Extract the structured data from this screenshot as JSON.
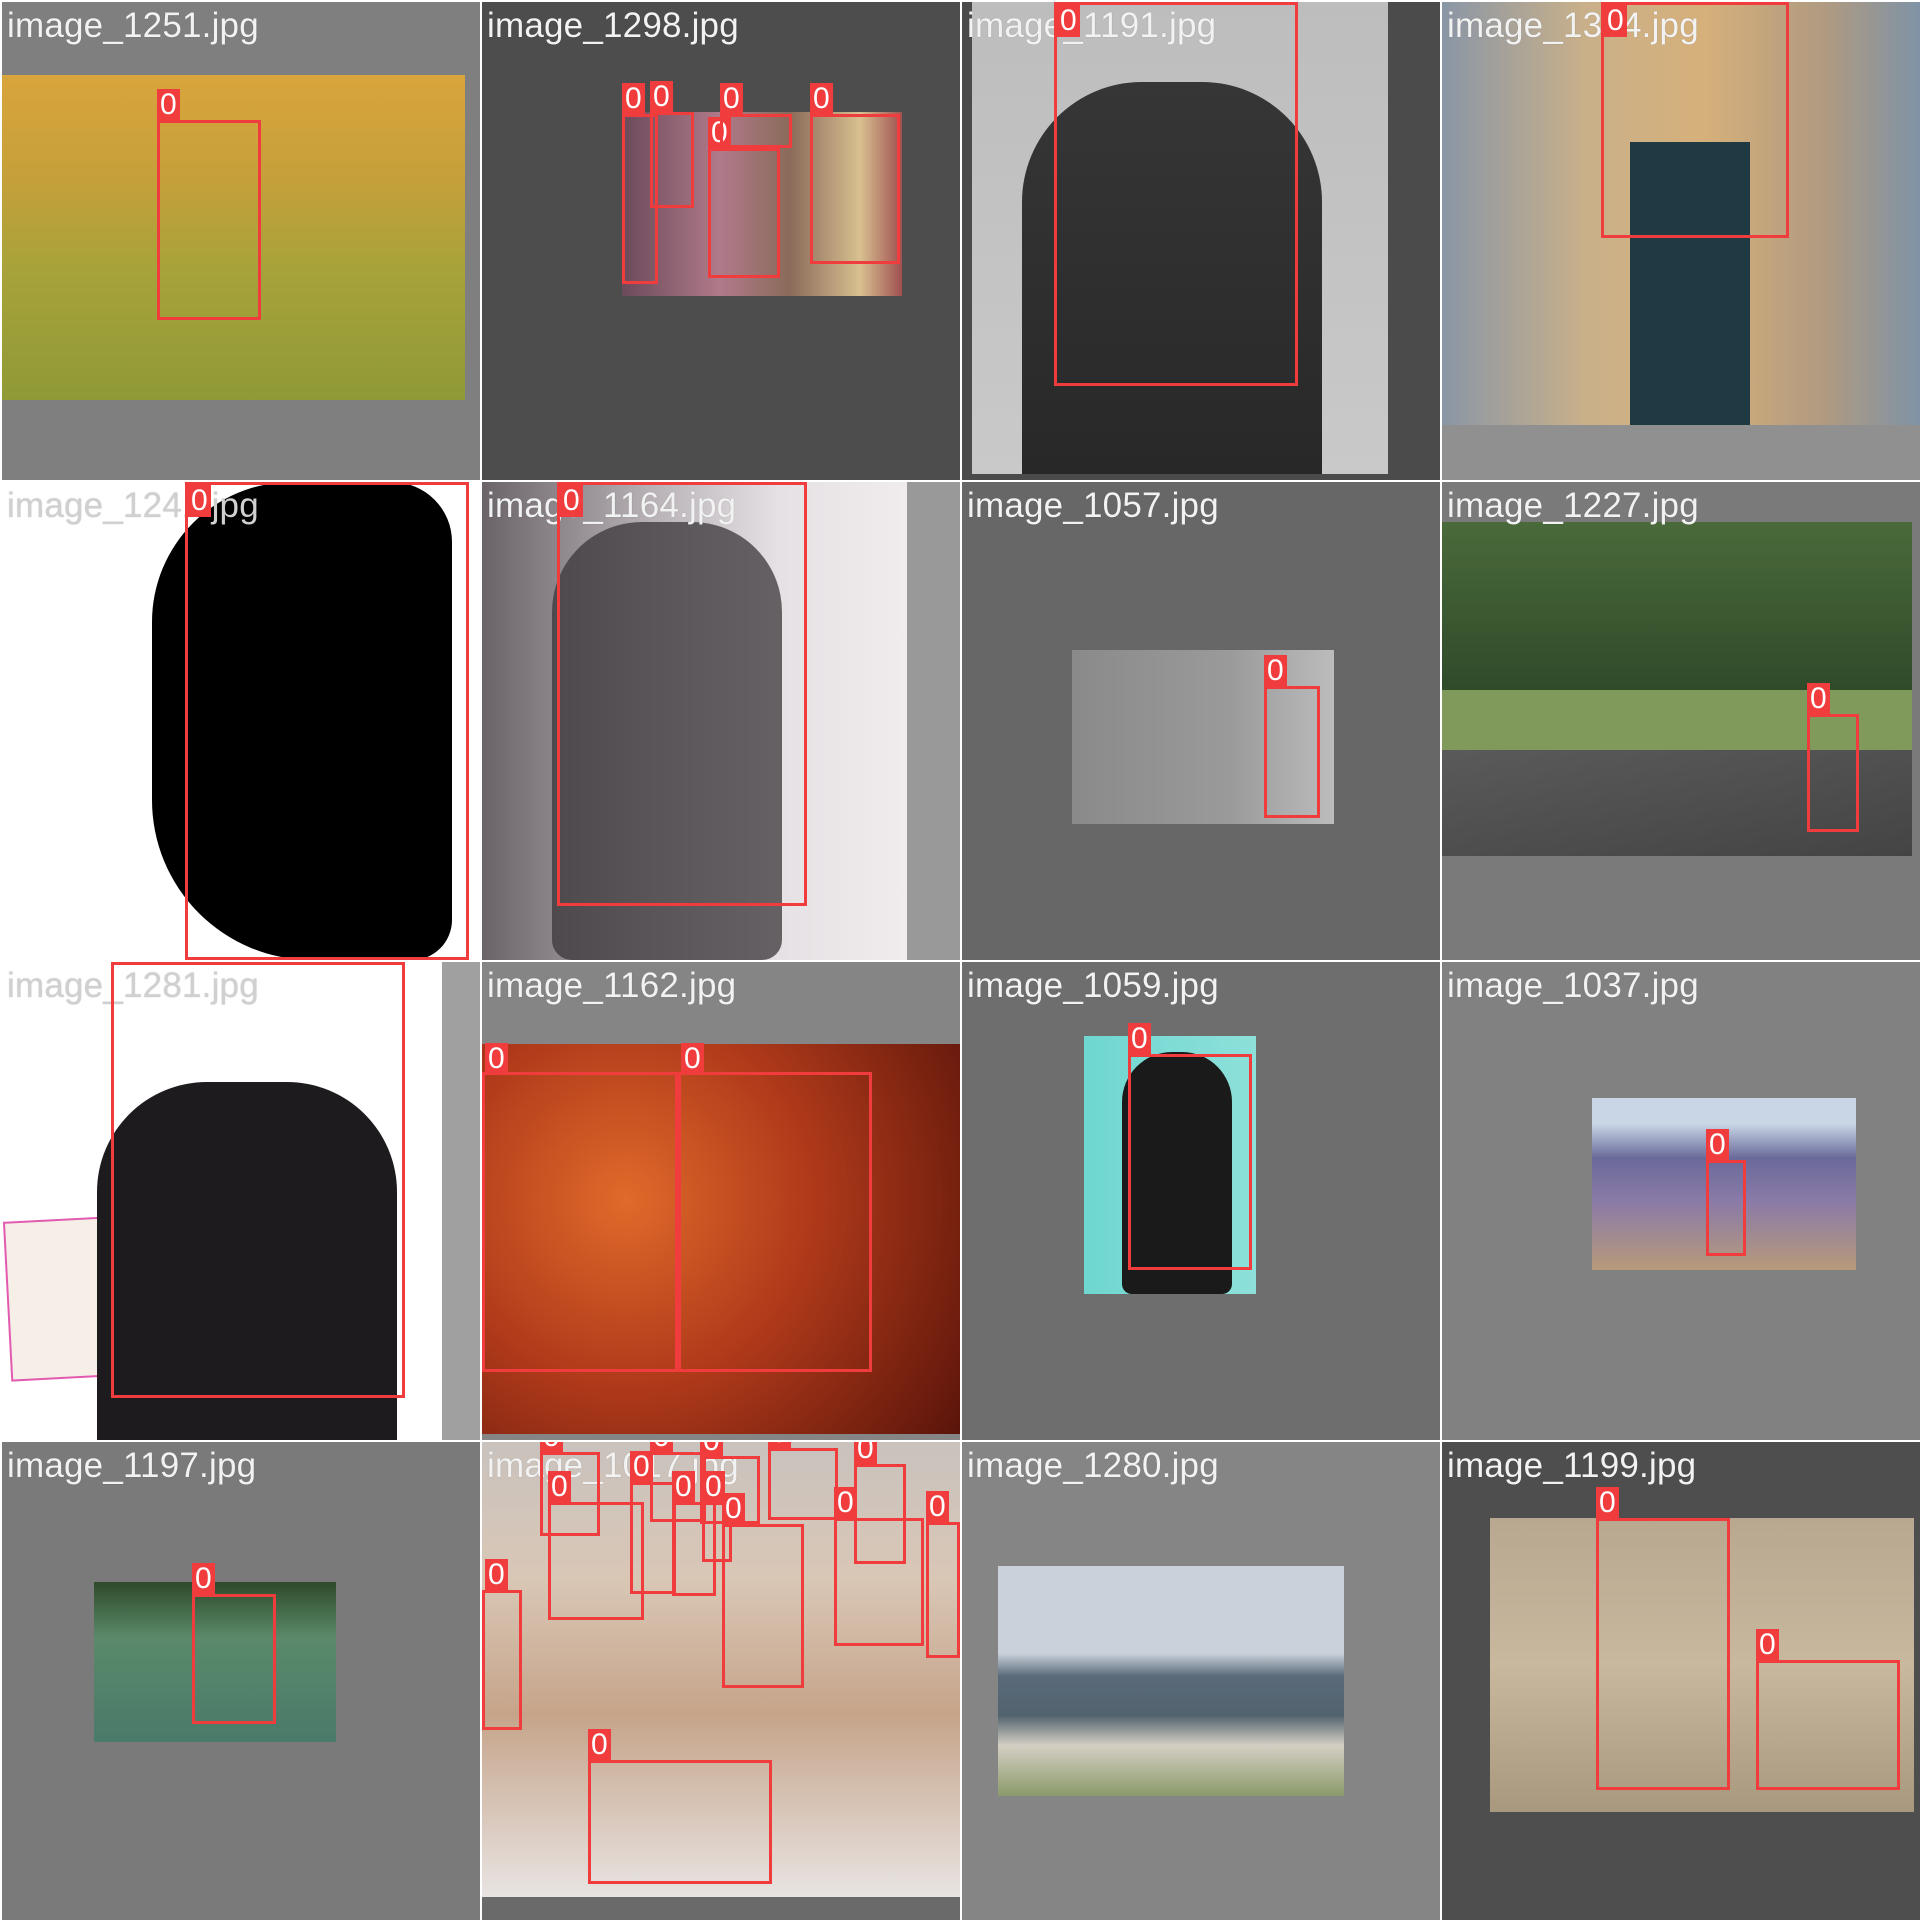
{
  "mosaic": {
    "tiles": [
      {
        "filename": "image_1251.jpg",
        "labels": [
          "0"
        ]
      },
      {
        "filename": "image_1298.jpg",
        "labels": [
          "0",
          "0",
          "0",
          "0",
          "0"
        ]
      },
      {
        "filename": "image_1191.jpg",
        "labels": [
          "0"
        ]
      },
      {
        "filename": "image_1304.jpg",
        "labels": [
          "0"
        ]
      },
      {
        "filename": "image_1241.jpg",
        "labels": [
          "0"
        ]
      },
      {
        "filename": "image_1164.jpg",
        "labels": [
          "0"
        ]
      },
      {
        "filename": "image_1057.jpg",
        "labels": [
          "0"
        ]
      },
      {
        "filename": "image_1227.jpg",
        "labels": [
          "0"
        ]
      },
      {
        "filename": "image_1281.jpg",
        "labels": [
          "0"
        ]
      },
      {
        "filename": "image_1162.jpg",
        "labels": [
          "0",
          "0"
        ]
      },
      {
        "filename": "image_1059.jpg",
        "labels": [
          "0"
        ]
      },
      {
        "filename": "image_1037.jpg",
        "labels": [
          "0"
        ]
      },
      {
        "filename": "image_1197.jpg",
        "labels": [
          "0"
        ]
      },
      {
        "filename": "image_1017.jpg",
        "labels": [
          "0",
          "0",
          "0",
          "0",
          "0",
          "0",
          "0",
          "0",
          "0",
          "0",
          "0",
          "0",
          "0",
          "0"
        ]
      },
      {
        "filename": "image_1280.jpg",
        "labels": []
      },
      {
        "filename": "image_1199.jpg",
        "labels": [
          "0",
          "0"
        ]
      }
    ]
  },
  "colors": {
    "box": "#f03c3c",
    "label_text": "#ffffff",
    "filename_text": "#f2f2f2"
  }
}
